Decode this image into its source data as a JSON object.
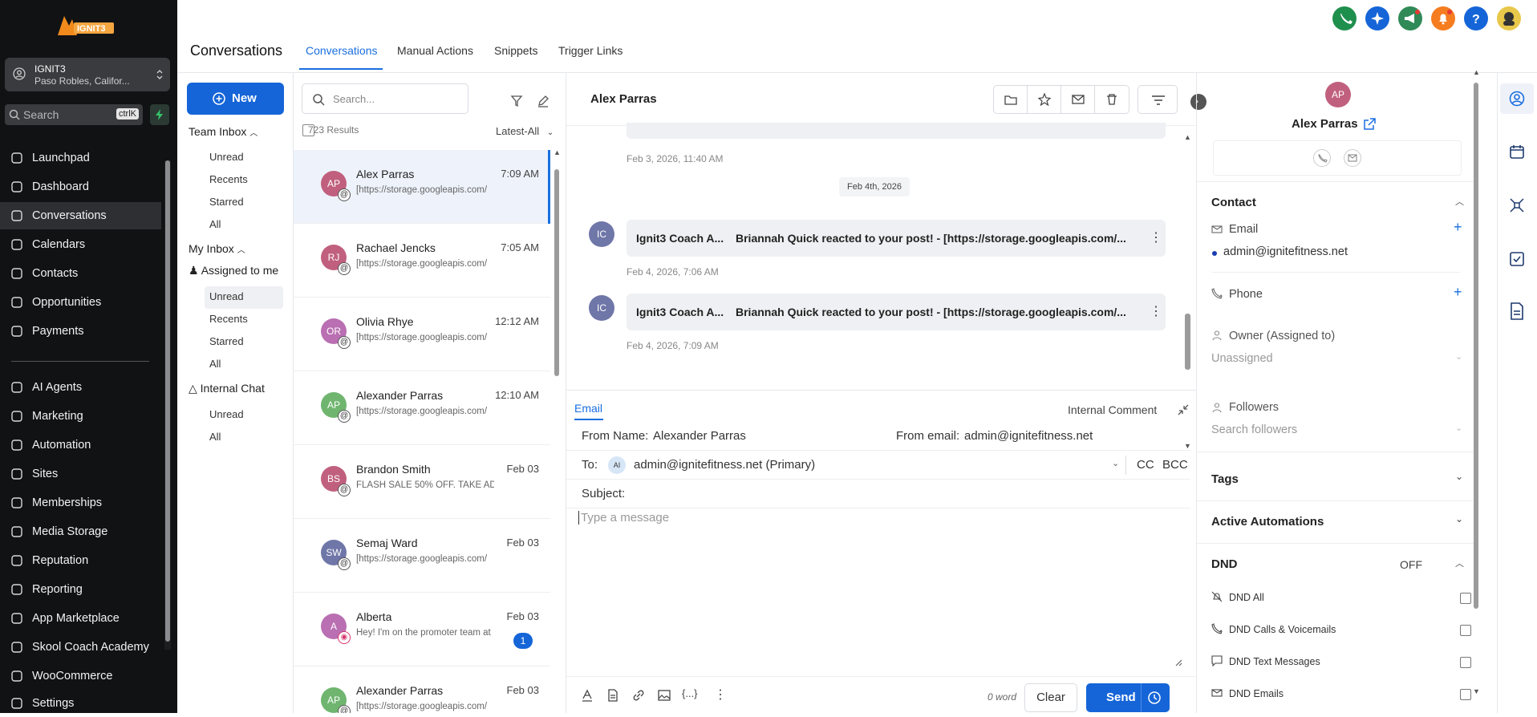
{
  "app": {
    "brand": "IGNIT3",
    "account_name": "IGNIT3",
    "account_location": "Paso Robles, Califor...",
    "search_label": "Search",
    "search_shortcut": "ctrlK"
  },
  "nav": [
    {
      "label": "Launchpad",
      "icon": "launchpad-icon"
    },
    {
      "label": "Dashboard",
      "icon": "dashboard-icon"
    },
    {
      "label": "Conversations",
      "icon": "chat-icon",
      "active": true
    },
    {
      "label": "Calendars",
      "icon": "calendar-icon"
    },
    {
      "label": "Contacts",
      "icon": "contacts-icon"
    },
    {
      "label": "Opportunities",
      "icon": "opportunities-icon"
    },
    {
      "label": "Payments",
      "icon": "payments-icon"
    },
    {
      "label": "AI Agents",
      "icon": "ai-agents-icon"
    },
    {
      "label": "Marketing",
      "icon": "marketing-icon"
    },
    {
      "label": "Automation",
      "icon": "automation-icon"
    },
    {
      "label": "Sites",
      "icon": "sites-icon"
    },
    {
      "label": "Memberships",
      "icon": "memberships-icon"
    },
    {
      "label": "Media Storage",
      "icon": "media-icon"
    },
    {
      "label": "Reputation",
      "icon": "star-icon"
    },
    {
      "label": "Reporting",
      "icon": "reporting-icon"
    },
    {
      "label": "App Marketplace",
      "icon": "marketplace-icon"
    },
    {
      "label": "Skool Coach Academy",
      "icon": "academy-icon"
    },
    {
      "label": "WooCommerce",
      "icon": "woocommerce-icon"
    },
    {
      "label": "Settings",
      "icon": "settings-icon"
    }
  ],
  "header": {
    "title": "Conversations",
    "tabs": [
      "Conversations",
      "Manual Actions",
      "Snippets",
      "Trigger Links"
    ],
    "active_tab": "Conversations"
  },
  "inbox": {
    "new_label": "New",
    "team_inbox": "Team Inbox",
    "team_items": [
      "Unread",
      "Recents",
      "Starred",
      "All"
    ],
    "my_inbox": "My Inbox",
    "assigned": "Assigned to me",
    "assigned_items": [
      "Unread",
      "Recents",
      "Starred",
      "All"
    ],
    "internal_chat": "Internal Chat",
    "internal_items": [
      "Unread",
      "All"
    ]
  },
  "list": {
    "search_placeholder": "Search...",
    "results": "723 Results",
    "sort": "Latest-All",
    "items": [
      {
        "initials": "AP",
        "name": "Alex Parras",
        "time": "7:09 AM",
        "preview": "[https://storage.googleapis.com/",
        "color": "#c0607e",
        "channel": "email",
        "selected": true
      },
      {
        "initials": "RJ",
        "name": "Rachael Jencks",
        "time": "7:05 AM",
        "preview": "[https://storage.googleapis.com/",
        "color": "#c0607e",
        "channel": "email"
      },
      {
        "initials": "OR",
        "name": "Olivia Rhye",
        "time": "12:12 AM",
        "preview": "[https://storage.googleapis.com/",
        "color": "#b96fb2",
        "channel": "email"
      },
      {
        "initials": "AP",
        "name": "Alexander Parras",
        "time": "12:10 AM",
        "preview": "[https://storage.googleapis.com/",
        "color": "#6fb56f",
        "channel": "email"
      },
      {
        "initials": "BS",
        "name": "Brandon Smith",
        "time": "Feb 03",
        "preview": "FLASH SALE 50% OFF. TAKE ADV",
        "color": "#c0607e",
        "channel": "email"
      },
      {
        "initials": "SW",
        "name": "Semaj Ward",
        "time": "Feb 03",
        "preview": "[https://storage.googleapis.com/",
        "color": "#6f76a8",
        "channel": "email"
      },
      {
        "initials": "A",
        "name": "Alberta",
        "time": "Feb 03",
        "preview": "Hey! I'm on the promoter team at",
        "color": "#b96fb2",
        "channel": "instagram",
        "unread": "1"
      },
      {
        "initials": "AP",
        "name": "Alexander Parras",
        "time": "Feb 03",
        "preview": "[https://storage.googleapis.com/",
        "color": "#6fb56f",
        "channel": "email"
      }
    ]
  },
  "thread": {
    "contact_name": "Alex Parras",
    "first_ts": "Feb 3, 2026, 11:40 AM",
    "date_divider": "Feb 4th, 2026",
    "messages": [
      {
        "avatar": "IC",
        "title": "Ignit3 Coach A...",
        "text": "Briannah Quick reacted to your post!  -  [https://storage.googleapis.com/...",
        "ts": "Feb 4, 2026, 7:06 AM"
      },
      {
        "avatar": "IC",
        "title": "Ignit3 Coach A...",
        "text": "Briannah Quick reacted to your post!  -  [https://storage.googleapis.com/...",
        "ts": "Feb 4, 2026, 7:09 AM"
      }
    ]
  },
  "composer": {
    "tab_email": "Email",
    "tab_internal": "Internal Comment",
    "from_name_label": "From Name:",
    "from_name": "Alexander Parras",
    "from_email_label": "From email:",
    "from_email": "admin@ignitefitness.net",
    "to_label": "To:",
    "to_avatar": "AI",
    "to_value": "admin@ignitefitness.net (Primary)",
    "cc": "CC",
    "bcc": "BCC",
    "subject_label": "Subject:",
    "message_placeholder": "Type a message",
    "word_count": "0 word",
    "clear": "Clear",
    "send": "Send"
  },
  "contact": {
    "initials": "AP",
    "name": "Alex Parras",
    "section_contact": "Contact",
    "email_label": "Email",
    "email_value": "admin@ignitefitness.net",
    "phone_label": "Phone",
    "owner_label": "Owner (Assigned to)",
    "owner_value": "Unassigned",
    "followers_label": "Followers",
    "followers_placeholder": "Search followers",
    "tags": "Tags",
    "automations": "Active Automations",
    "dnd": "DND",
    "dnd_status": "OFF",
    "dnd_items": [
      "DND All",
      "DND Calls & Voicemails",
      "DND Text Messages",
      "DND Emails"
    ]
  },
  "colors": {
    "accent": "#1565d8",
    "sidebar_bg": "#111214"
  }
}
